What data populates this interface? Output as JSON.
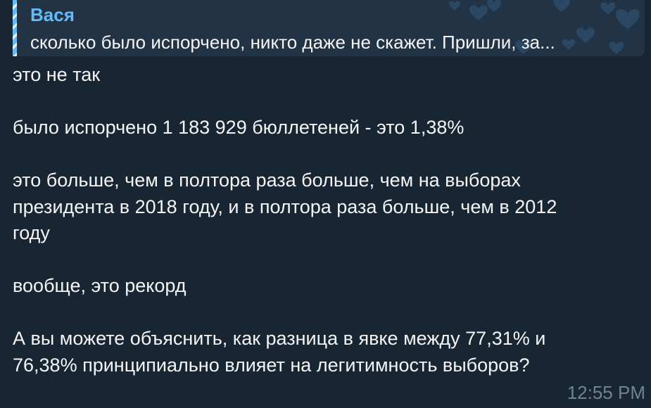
{
  "reply": {
    "author": "Вася",
    "text": "сколько было испорчено, никто даже не скажет. Пришли, за..."
  },
  "message": {
    "text": "это не так\n\nбыло испорчено 1 183 929 бюллетеней - это 1,38%\n\nэто больше, чем в полтора раза больше, чем на выборах\nпрезидента в 2018 году, и в полтора раза больше, чем в 2012\nгоду\n\nвообще, это рекорд\n\nА вы можете объяснить, как разница в явке между 77,31% и\n76,38% принципиально влияет на легитимность выборов?",
    "time": "12:55 PM"
  },
  "colors": {
    "background": "#182533",
    "reply_background": "#223345",
    "accent": "#62bcf9",
    "text": "#f5f5f5",
    "time": "#6f8397"
  },
  "icons": {
    "reply_decoration": "heart-icon"
  }
}
